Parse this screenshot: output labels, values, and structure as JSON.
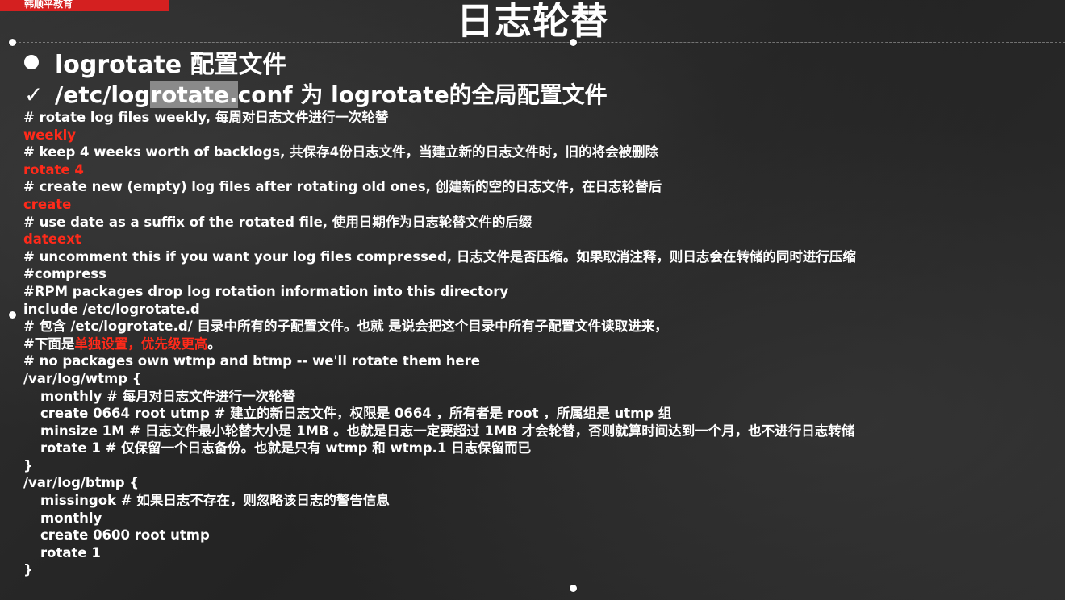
{
  "slide": {
    "title": "日志轮替",
    "corner_tab": "韩顺平教育"
  },
  "headings": {
    "bullet_text": "logrotate 配置文件",
    "check_mark": "✓",
    "check_text_pre": "/etc/log",
    "check_text_hl": "rotate.",
    "check_text_post": "conf 为 logrotate的全局配置文件"
  },
  "code_lines": {
    "l1": "# rotate log files weekly, 每周对日志文件进行一次轮替",
    "l2": "weekly",
    "l3": "# keep 4 weeks worth of backlogs, 共保存4份日志文件，当建立新的日志文件时，旧的将会被删除",
    "l4": "rotate 4",
    "l5": "# create new (empty) log files after rotating old ones, 创建新的空的日志文件，在日志轮替后",
    "l6": "create",
    "l7": "# use date as a suffix of the rotated file, 使用日期作为日志轮替文件的后缀",
    "l8": "dateext",
    "l9": "# uncomment this if you want your log files compressed, 日志文件是否压缩。如果取消注释，则日志会在转储的同时进行压缩",
    "l10": "#compress",
    "l11": "#RPM packages drop log rotation information into this directory",
    "l12": "include /etc/logrotate.d",
    "l13": "# 包含 /etc/logrotate.d/ 目录中所有的子配置文件。也就 是说会把这个目录中所有子配置文件读取进来，",
    "l14_pre": "#下面是",
    "l14_red": "单独设置，优先级更高",
    "l14_post": "。",
    "l15": "# no packages own wtmp and btmp -- we'll rotate them here",
    "l16": "/var/log/wtmp {",
    "l17": "monthly # 每月对日志文件进行一次轮替",
    "l18": "create 0664 root utmp # 建立的新日志文件，权限是 0664 ，所有者是 root ，所属组是 utmp 组",
    "l19": "minsize 1M   # 日志文件最小轮替大小是 1MB 。也就是日志一定要超过 1MB 才会轮替，否则就算时间达到一个月，也不进行日志转储",
    "l20": "rotate 1 # 仅保留一个日志备份。也就是只有 wtmp 和 wtmp.1 日志保留而已",
    "l21": "}",
    "l22": "/var/log/btmp {",
    "l23": "missingok # 如果日志不存在，则忽略该日志的警告信息",
    "l24": "monthly",
    "l25": "create 0600 root utmp",
    "l26": "rotate 1",
    "l27": "}"
  },
  "colors": {
    "background": "#2b2b2b",
    "text": "#ffffff",
    "keyword_red": "#ff2a1a",
    "corner_tab_red": "#d42020",
    "highlight_gray": "#8a8a8a"
  }
}
